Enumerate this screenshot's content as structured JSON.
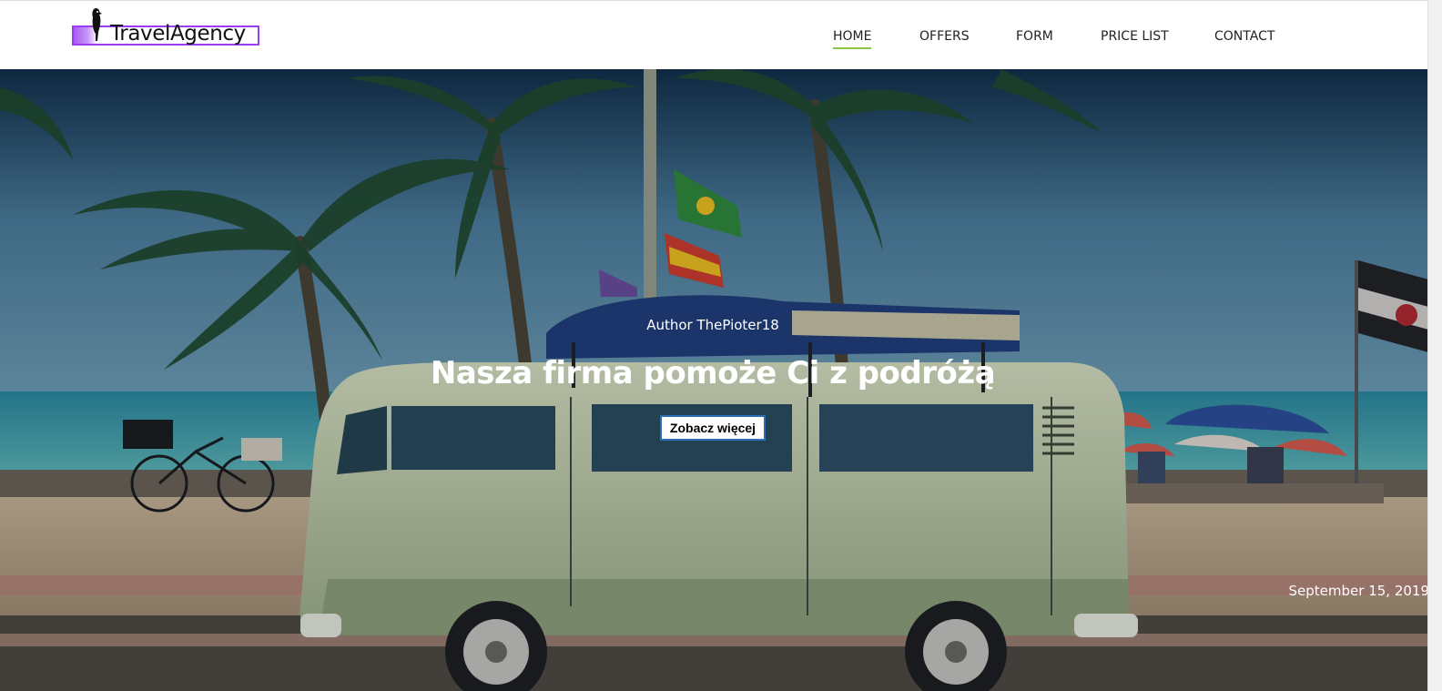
{
  "header": {
    "logo_text": "TravelAgency",
    "nav": [
      {
        "label": "HOME",
        "active": true
      },
      {
        "label": "OFFERS",
        "active": false
      },
      {
        "label": "FORM",
        "active": false
      },
      {
        "label": "PRICE LIST",
        "active": false
      },
      {
        "label": "CONTACT",
        "active": false
      }
    ]
  },
  "hero": {
    "author": "Author ThePioter18",
    "headline": "Nasza firma pomoże Ci z podróżą",
    "cta_label": "Zobacz więcej",
    "date": "September 15, 2019"
  },
  "colors": {
    "accent_logo": "#9b3cf0",
    "nav_active_underline": "#8ec63f",
    "cta_border": "#2f6fb5"
  },
  "icons": {
    "logo_mark": "parrot-icon"
  }
}
